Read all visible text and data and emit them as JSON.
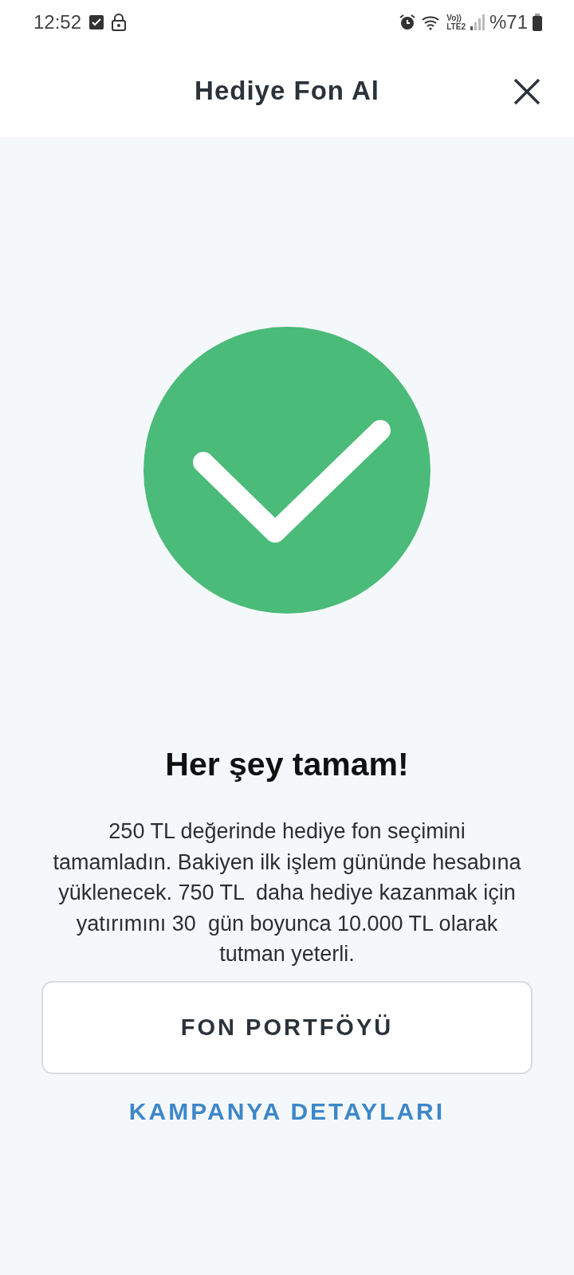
{
  "status_bar": {
    "time": "12:52",
    "network": [
      "Vo))",
      "LTE2"
    ],
    "battery": "%71"
  },
  "header": {
    "title": "Hediye Fon Al"
  },
  "result": {
    "heading": "Her şey tamam!",
    "message": "250 TL değerinde hediye fon seçimini tamamladın. Bakiyen ilk işlem gününde hesabına yüklenecek. 750 TL  daha hediye kazanmak için yatırımını 30  gün boyunca 10.000 TL olarak tutman yeterli."
  },
  "buttons": [
    {
      "kind": "outlined",
      "label": "FON PORTFÖYÜ"
    },
    {
      "kind": "link",
      "label": "KAMPANYA DETAYLARI"
    }
  ]
}
